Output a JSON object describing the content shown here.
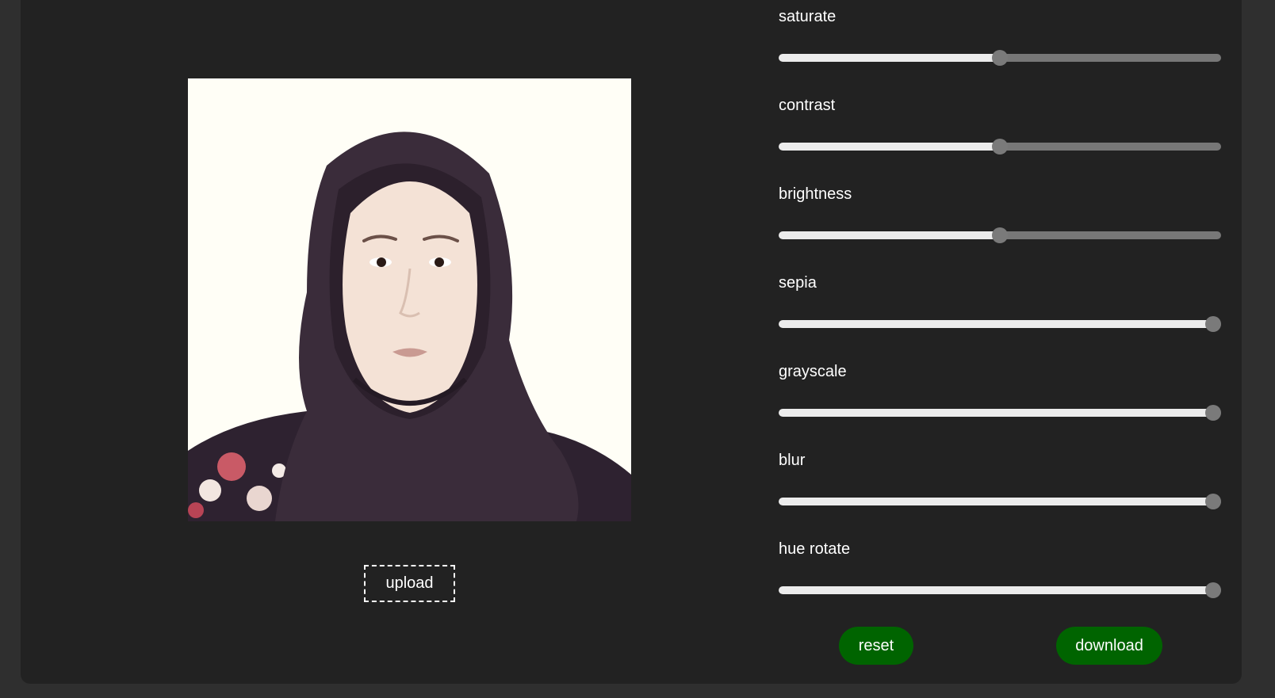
{
  "editor": {
    "photo": {
      "description_icon": "portrait-photo",
      "background_color": "#fffef6"
    },
    "upload_label": "upload"
  },
  "filters": [
    {
      "key": "saturate",
      "label": "saturate",
      "value_fraction": 0.5
    },
    {
      "key": "contrast",
      "label": "contrast",
      "value_fraction": 0.5
    },
    {
      "key": "brightness",
      "label": "brightness",
      "value_fraction": 0.5
    },
    {
      "key": "sepia",
      "label": "sepia",
      "value_fraction": 1.0
    },
    {
      "key": "grayscale",
      "label": "grayscale",
      "value_fraction": 1.0
    },
    {
      "key": "blur",
      "label": "blur",
      "value_fraction": 1.0
    },
    {
      "key": "hue-rotate",
      "label": "hue rotate",
      "value_fraction": 1.0
    }
  ],
  "actions": {
    "reset_label": "reset",
    "download_label": "download"
  },
  "colors": {
    "page_background": "#2f2f2f",
    "panel_background": "#222222",
    "button_green": "#006400",
    "slider_fill": "#ececec",
    "slider_track": "#777777"
  }
}
